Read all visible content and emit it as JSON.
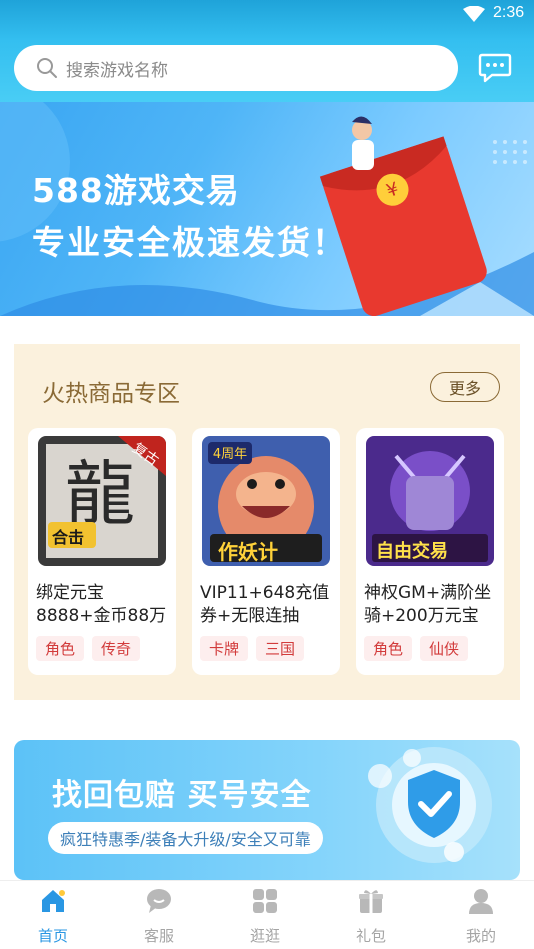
{
  "status_bar": {
    "time": "2:36"
  },
  "search": {
    "placeholder": "搜索游戏名称"
  },
  "banner": {
    "line1": "588游戏交易",
    "line2": "专业安全极速发货！"
  },
  "hot_section": {
    "title": "火热商品专区",
    "more_label": "更多",
    "products": [
      {
        "title": "绑定元宝8888+金币88万",
        "tags": [
          "角色",
          "传奇"
        ],
        "thumb_text": "合击"
      },
      {
        "title": "VIP11+648充值券+无限连抽",
        "tags": [
          "卡牌",
          "三国"
        ],
        "thumb_text": "作妖计"
      },
      {
        "title": "神权GM+满阶坐骑+200万元宝",
        "tags": [
          "角色",
          "仙侠"
        ],
        "thumb_text": "自由交易"
      }
    ]
  },
  "banner2": {
    "title": "找回包赔 买号安全",
    "subtitle": "疯狂特惠季/装备大升级/安全又可靠"
  },
  "bottom_nav": [
    {
      "label": "首页",
      "icon": "home-icon",
      "active": true
    },
    {
      "label": "客服",
      "icon": "chat-bubble-icon",
      "active": false
    },
    {
      "label": "逛逛",
      "icon": "grid-icon",
      "active": false
    },
    {
      "label": "礼包",
      "icon": "gift-icon",
      "active": false
    },
    {
      "label": "我的",
      "icon": "user-icon",
      "active": false
    }
  ],
  "colors": {
    "accent": "#2a97e3",
    "header": "#34bff0",
    "tag_text": "#d23b3b",
    "hot_bg": "#fbf1dd"
  }
}
